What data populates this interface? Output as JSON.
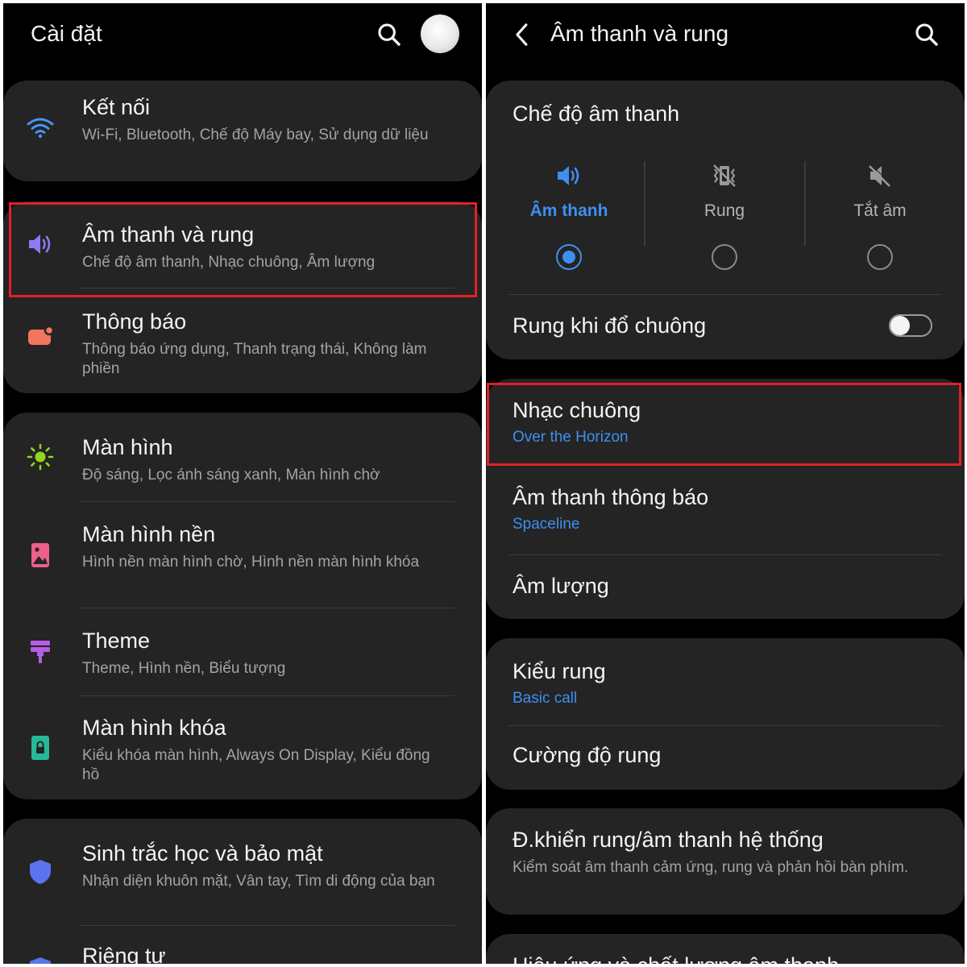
{
  "left": {
    "header": {
      "title": "Cài đặt",
      "search_icon": "search-icon",
      "avatar_icon": "avatar"
    },
    "items": [
      {
        "title": "Kết nối",
        "subtitle": "Wi-Fi, Bluetooth, Chế độ Máy bay, Sử dụng dữ liệu",
        "icon": "wifi-icon",
        "icon_color": "#4a93f3"
      },
      {
        "title": "Âm thanh và rung",
        "subtitle": "Chế độ âm thanh, Nhạc chuông, Âm lượng",
        "icon": "volume-icon",
        "icon_color": "#8b7cf3"
      },
      {
        "title": "Thông báo",
        "subtitle": "Thông báo ứng dụng, Thanh trạng thái, Không làm phiền",
        "icon": "notification-icon",
        "icon_color": "#f2765f"
      },
      {
        "title": "Màn hình",
        "subtitle": "Độ sáng, Lọc ánh sáng xanh, Màn hình chờ",
        "icon": "brightness-icon",
        "icon_color": "#8fd61d"
      },
      {
        "title": "Màn hình nền",
        "subtitle": "Hình nền màn hình chờ, Hình nền màn hình khóa",
        "icon": "wallpaper-icon",
        "icon_color": "#ef5f8b"
      },
      {
        "title": "Theme",
        "subtitle": "Theme, Hình nền, Biểu tượng",
        "icon": "theme-brush-icon",
        "icon_color": "#b65de6"
      },
      {
        "title": "Màn hình khóa",
        "subtitle": "Kiểu khóa màn hình, Always On Display, Kiểu đồng hồ",
        "icon": "lock-icon",
        "icon_color": "#27b89a"
      },
      {
        "title": "Sinh trắc học và bảo mật",
        "subtitle": "Nhận diện khuôn mặt, Vân tay, Tìm di động của bạn",
        "icon": "shield-icon",
        "icon_color": "#5b73ee"
      },
      {
        "title": "Riêng tư",
        "subtitle": "",
        "icon": "privacy-shield-icon",
        "icon_color": "#5b73ee"
      }
    ]
  },
  "right": {
    "header": {
      "title": "Âm thanh và rung",
      "back_icon": "back-chevron-icon",
      "search_icon": "search-icon"
    },
    "sound_mode": {
      "title": "Chế độ âm thanh",
      "options": [
        {
          "label": "Âm thanh",
          "icon": "volume-icon",
          "selected": true
        },
        {
          "label": "Rung",
          "icon": "vibrate-icon",
          "selected": false
        },
        {
          "label": "Tắt âm",
          "icon": "mute-icon",
          "selected": false
        }
      ]
    },
    "vibrate_while_ringing": {
      "label": "Rung khi đổ chuông",
      "enabled": false
    },
    "ringtone": {
      "title": "Nhạc chuông",
      "value": "Over the Horizon"
    },
    "notification_sound": {
      "title": "Âm thanh thông báo",
      "value": "Spaceline"
    },
    "volume": {
      "title": "Âm lượng"
    },
    "vibration_pattern": {
      "title": "Kiểu rung",
      "value": "Basic call"
    },
    "vibration_intensity": {
      "title": "Cường độ rung"
    },
    "system_control": {
      "title": "Đ.khiển rung/âm thanh hệ thống",
      "subtitle": "Kiểm soát âm thanh cảm ứng, rung và phản hồi bàn phím."
    },
    "effects": {
      "title": "Hiệu ứng và chất lượng âm thanh"
    }
  },
  "colors": {
    "accent": "#3e8ff1",
    "highlight": "#e02128",
    "card": "#242424",
    "background": "#000000"
  }
}
